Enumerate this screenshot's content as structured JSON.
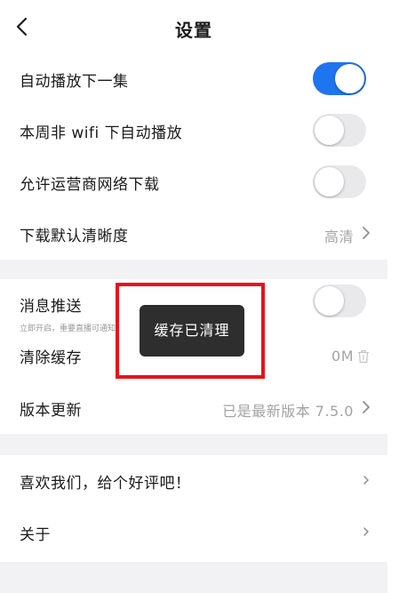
{
  "header": {
    "title": "设置"
  },
  "settings": {
    "autoplay_next": {
      "label": "自动播放下一集",
      "on": true
    },
    "non_wifi_autoplay": {
      "label": "本周非 wifi 下自动播放",
      "on": false
    },
    "carrier_download": {
      "label": "允许运营商网络下载",
      "on": false
    },
    "download_quality": {
      "label": "下载默认清晰度",
      "value": "高清"
    },
    "push": {
      "label": "消息推送",
      "sublabel": "立即开启，重要直播可通知",
      "on": false
    },
    "clear_cache": {
      "label": "清除缓存",
      "value": "0M"
    },
    "version": {
      "label": "版本更新",
      "value": "已是最新版本 7.5.0"
    },
    "rate_us": {
      "label": "喜欢我们，给个好评吧！"
    },
    "about": {
      "label": "关于"
    }
  },
  "toast": {
    "text": "缓存已清理"
  },
  "colors": {
    "accent": "#1f74f0",
    "highlight": "#e8111b"
  }
}
